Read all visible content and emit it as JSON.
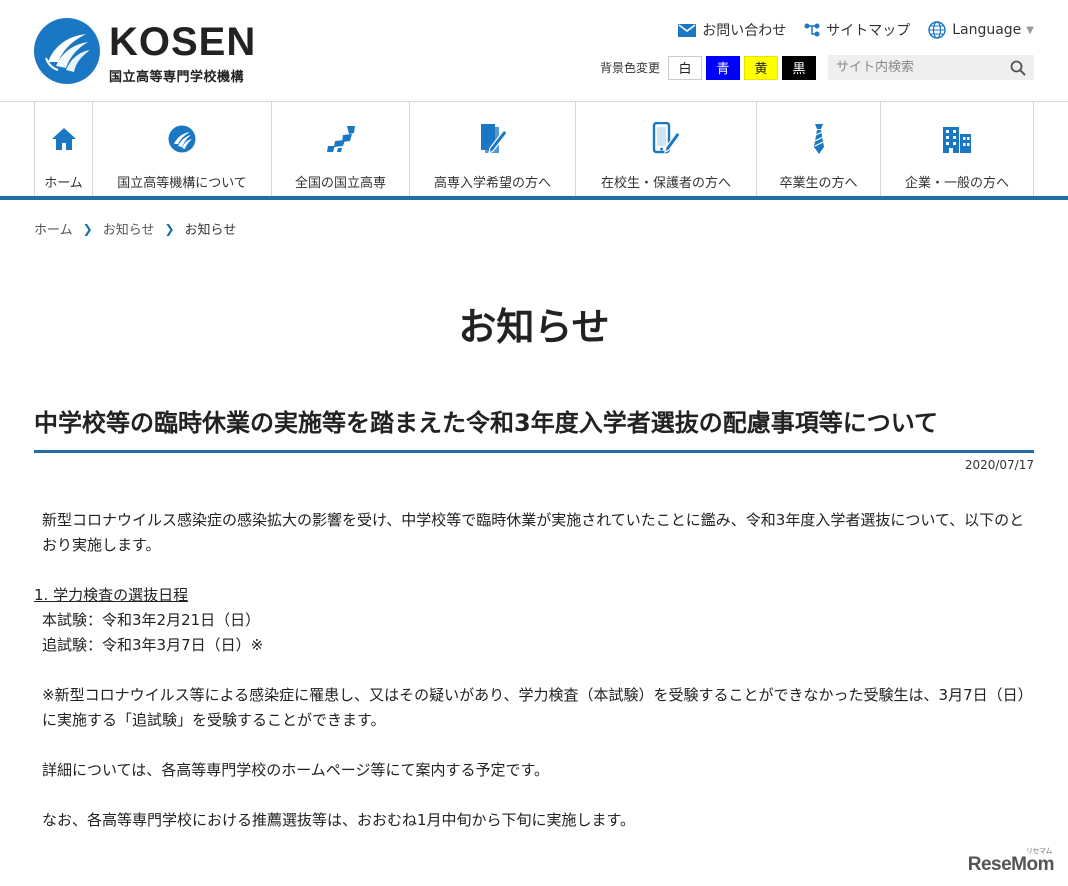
{
  "header": {
    "logo_en": "KOSEN",
    "logo_jp": "国立高等専門学校機構",
    "links": {
      "contact": "お問い合わせ",
      "sitemap": "サイトマップ",
      "language": "Language"
    },
    "bg_color_label": "背景色変更",
    "swatches": {
      "white": "白",
      "blue": "青",
      "yellow": "黄",
      "black": "黒"
    },
    "search_placeholder": "サイト内検索"
  },
  "nav": {
    "items": [
      {
        "label": "ホーム",
        "icon": "home-icon"
      },
      {
        "label": "国立高等機構について",
        "icon": "kosen-logo-icon"
      },
      {
        "label": "全国の国立高専",
        "icon": "map-icon"
      },
      {
        "label": "高専入学希望の方へ",
        "icon": "notebook-pen-icon"
      },
      {
        "label": "在校生・保護者の方へ",
        "icon": "smartphone-pen-icon"
      },
      {
        "label": "卒業生の方へ",
        "icon": "necktie-icon"
      },
      {
        "label": "企業・一般の方へ",
        "icon": "building-icon"
      }
    ],
    "accent_color": "#1e6fa6"
  },
  "breadcrumb": {
    "home": "ホーム",
    "level1": "お知らせ",
    "current": "お知らせ"
  },
  "page": {
    "title": "お知らせ"
  },
  "article": {
    "title": "中学校等の臨時休業の実施等を踏まえた令和3年度入学者選抜の配慮事項等について",
    "date": "2020/07/17",
    "intro": "新型コロナウイルス感染症の感染拡大の影響を受け、中学校等で臨時休業が実施されていたことに鑑み、令和3年度入学者選抜について、以下のとおり実施します。",
    "section1_heading": "1.  学力検査の選抜日程",
    "main_exam": "本試験：令和3年2月21日（日）",
    "makeup_exam": "追試験：令和3年3月7日（日）※",
    "note": "※新型コロナウイルス等による感染症に罹患し、又はその疑いがあり、学力検査（本試験）を受験することができなかった受験生は、3月7日（日）に実施する「追試験」を受験することができます。",
    "details": "詳細については、各高等専門学校のホームページ等にて案内する予定です。",
    "recommendation": "なお、各高等専門学校における推薦選抜等は、おおむね1月中旬から下旬に実施します。"
  },
  "watermark": {
    "brand": "ReseMom",
    "small": "リセマム"
  }
}
